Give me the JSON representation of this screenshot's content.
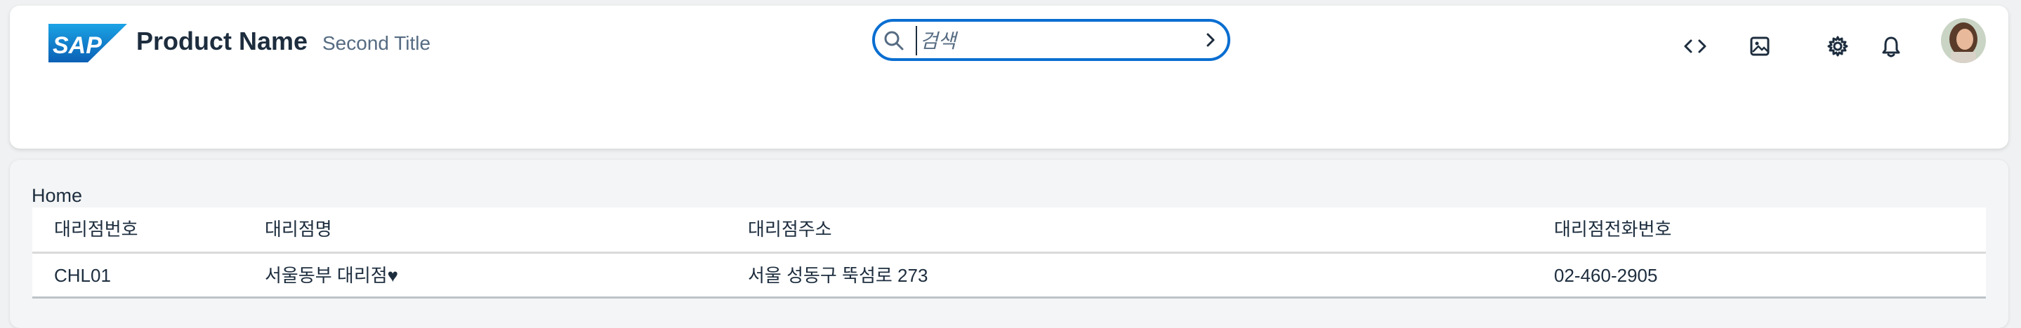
{
  "header": {
    "logo_text": "SAP",
    "product_name": "Product Name",
    "second_title": "Second Title",
    "search": {
      "placeholder": "검색",
      "value": ""
    },
    "icons": [
      "code-icon",
      "image-icon",
      "settings-icon",
      "notification-bell-icon"
    ],
    "brand_color": "#0a6ed1"
  },
  "breadcrumb": "Home",
  "table": {
    "columns": [
      "대리점번호",
      "대리점명",
      "대리점주소",
      "대리점전화번호"
    ],
    "rows": [
      [
        "CHL01",
        "서울동부 대리점♥",
        "서울 성동구 뚝섬로 273",
        "02-460-2905"
      ]
    ]
  }
}
